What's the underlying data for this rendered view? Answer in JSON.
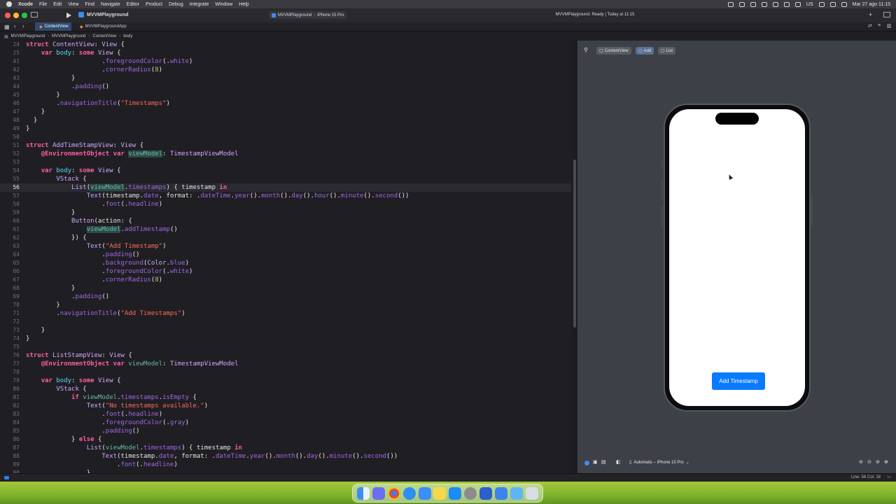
{
  "menubar": {
    "app": "Xcode",
    "items": [
      "File",
      "Edit",
      "View",
      "Find",
      "Navigate",
      "Editor",
      "Product",
      "Debug",
      "Integrate",
      "Window",
      "Help"
    ],
    "input_source": "US",
    "clock": "Mar 27 ago 11:15"
  },
  "toolbar": {
    "project": "MVVMPlayground",
    "scheme": "MVVMPlayground",
    "destination": "iPhone 15 Pro",
    "status": "MVVMPlayground: Ready | Today at 11:15"
  },
  "tabs": [
    "ContentView",
    "MVVMPlaygroundApp"
  ],
  "breadcrumb": [
    "MVVMPlayground",
    "MVVMPlayground",
    "ContentView",
    "body"
  ],
  "editor": {
    "current_line": "56",
    "lines": [
      {
        "n": "24",
        "c": "struct ContentView: View {"
      },
      {
        "n": "25",
        "c": "    var body: some View {"
      },
      {
        "n": "41",
        "c": "                    .foregroundColor(.white)"
      },
      {
        "n": "42",
        "c": "                    .cornerRadius(8)"
      },
      {
        "n": "43",
        "c": "            }"
      },
      {
        "n": "44",
        "c": "            .padding()"
      },
      {
        "n": "45",
        "c": "        }"
      },
      {
        "n": "46",
        "c": "        .navigationTitle(\"Timestamps\")"
      },
      {
        "n": "47",
        "c": "    }"
      },
      {
        "n": "48",
        "c": "  }"
      },
      {
        "n": "49",
        "c": "}"
      },
      {
        "n": "50",
        "c": ""
      },
      {
        "n": "51",
        "c": "struct AddTimeStampView: View {"
      },
      {
        "n": "52",
        "c": "    @EnvironmentObject var viewModel: TimestampViewModel"
      },
      {
        "n": "53",
        "c": ""
      },
      {
        "n": "54",
        "c": "    var body: some View {"
      },
      {
        "n": "55",
        "c": "        VStack {"
      },
      {
        "n": "56",
        "c": "            List(viewModel.timestamps) { timestamp in"
      },
      {
        "n": "57",
        "c": "                Text(timestamp.date, format: .dateTime.year().month().day().hour().minute().second())"
      },
      {
        "n": "58",
        "c": "                    .font(.headline)"
      },
      {
        "n": "59",
        "c": "            }"
      },
      {
        "n": "60",
        "c": "            Button(action: {"
      },
      {
        "n": "61",
        "c": "                viewModel.addTimestamp()"
      },
      {
        "n": "62",
        "c": "            }) {"
      },
      {
        "n": "63",
        "c": "                Text(\"Add Timestamp\")"
      },
      {
        "n": "64",
        "c": "                    .padding()"
      },
      {
        "n": "65",
        "c": "                    .background(Color.blue)"
      },
      {
        "n": "66",
        "c": "                    .foregroundColor(.white)"
      },
      {
        "n": "67",
        "c": "                    .cornerRadius(8)"
      },
      {
        "n": "68",
        "c": "            }"
      },
      {
        "n": "69",
        "c": "            .padding()"
      },
      {
        "n": "70",
        "c": "        }"
      },
      {
        "n": "71",
        "c": "        .navigationTitle(\"Add Timestamps\")"
      },
      {
        "n": "72",
        "c": ""
      },
      {
        "n": "73",
        "c": "    }"
      },
      {
        "n": "74",
        "c": "}"
      },
      {
        "n": "75",
        "c": ""
      },
      {
        "n": "76",
        "c": "struct ListStampView: View {"
      },
      {
        "n": "77",
        "c": "    @EnvironmentObject var viewModel: TimestampViewModel"
      },
      {
        "n": "78",
        "c": ""
      },
      {
        "n": "79",
        "c": "    var body: some View {"
      },
      {
        "n": "80",
        "c": "        VStack {"
      },
      {
        "n": "81",
        "c": "            if viewModel.timestamps.isEmpty {"
      },
      {
        "n": "82",
        "c": "                Text(\"No timestamps available.\")"
      },
      {
        "n": "83",
        "c": "                    .font(.headline)"
      },
      {
        "n": "84",
        "c": "                    .foregroundColor(.gray)"
      },
      {
        "n": "85",
        "c": "                    .padding()"
      },
      {
        "n": "86",
        "c": "            } else {"
      },
      {
        "n": "87",
        "c": "                List(viewModel.timestamps) { timestamp in"
      },
      {
        "n": "88",
        "c": "                    Text(timestamp.date, format: .dateTime.year().month().day().minute().second())"
      },
      {
        "n": "89",
        "c": "                        .font(.headline)"
      },
      {
        "n": "90",
        "c": "                }"
      }
    ]
  },
  "preview": {
    "buttons": [
      "ContentView",
      "Add",
      "List"
    ],
    "active_button": "Add",
    "phone_button": "Add Timestamp",
    "device_menu": "Automatic – iPhone 15 Pro"
  },
  "statusbar": {
    "position": "Line: 56  Col: 18"
  },
  "colors": {
    "accent": "#0a7aff",
    "editor_bg": "#1f1f23",
    "preview_bg": "#3d4046"
  }
}
